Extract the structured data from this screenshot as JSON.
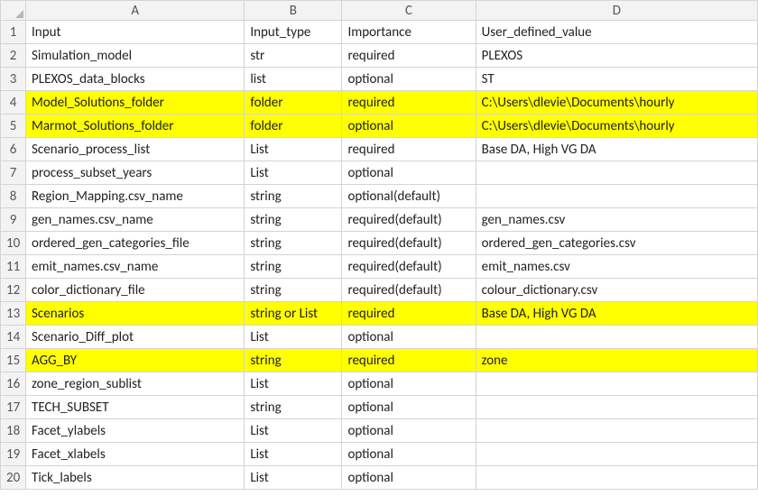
{
  "columns": [
    "A",
    "B",
    "C",
    "D"
  ],
  "rows": [
    {
      "n": 1,
      "hl": false,
      "cells": [
        "Input",
        "Input_type",
        "Importance",
        "User_defined_value"
      ]
    },
    {
      "n": 2,
      "hl": false,
      "cells": [
        "Simulation_model",
        "str",
        "required",
        "PLEXOS"
      ]
    },
    {
      "n": 3,
      "hl": false,
      "cells": [
        "PLEXOS_data_blocks",
        "list",
        "optional",
        "ST"
      ]
    },
    {
      "n": 4,
      "hl": true,
      "cells": [
        "Model_Solutions_folder",
        "folder",
        "required",
        "C:\\Users\\dlevie\\Documents\\hourly"
      ]
    },
    {
      "n": 5,
      "hl": true,
      "cells": [
        "Marmot_Solutions_folder",
        "folder",
        "optional",
        "C:\\Users\\dlevie\\Documents\\hourly"
      ]
    },
    {
      "n": 6,
      "hl": false,
      "cells": [
        "Scenario_process_list",
        "List",
        "required",
        "Base DA, High VG DA"
      ]
    },
    {
      "n": 7,
      "hl": false,
      "cells": [
        "process_subset_years",
        "List",
        "optional",
        ""
      ]
    },
    {
      "n": 8,
      "hl": false,
      "cells": [
        "Region_Mapping.csv_name",
        "string",
        "optional(default)",
        ""
      ]
    },
    {
      "n": 9,
      "hl": false,
      "cells": [
        "gen_names.csv_name",
        "string",
        "required(default)",
        "gen_names.csv"
      ]
    },
    {
      "n": 10,
      "hl": false,
      "cells": [
        "ordered_gen_categories_file",
        "string",
        "required(default)",
        "ordered_gen_categories.csv"
      ]
    },
    {
      "n": 11,
      "hl": false,
      "cells": [
        "emit_names.csv_name",
        "string",
        "required(default)",
        "emit_names.csv"
      ]
    },
    {
      "n": 12,
      "hl": false,
      "cells": [
        "color_dictionary_file",
        "string",
        "required(default)",
        "colour_dictionary.csv"
      ]
    },
    {
      "n": 13,
      "hl": true,
      "cells": [
        "Scenarios",
        "string or List",
        "required",
        "Base DA, High VG DA"
      ]
    },
    {
      "n": 14,
      "hl": false,
      "cells": [
        "Scenario_Diff_plot",
        "List",
        "optional",
        ""
      ]
    },
    {
      "n": 15,
      "hl": true,
      "cells": [
        "AGG_BY",
        "string",
        "required",
        "zone"
      ]
    },
    {
      "n": 16,
      "hl": false,
      "cells": [
        "zone_region_sublist",
        "List",
        "optional",
        ""
      ]
    },
    {
      "n": 17,
      "hl": false,
      "cells": [
        "TECH_SUBSET",
        "string",
        "optional",
        ""
      ]
    },
    {
      "n": 18,
      "hl": false,
      "cells": [
        "Facet_ylabels",
        "List",
        "optional",
        ""
      ]
    },
    {
      "n": 19,
      "hl": false,
      "cells": [
        "Facet_xlabels",
        "List",
        "optional",
        ""
      ]
    },
    {
      "n": 20,
      "hl": false,
      "cells": [
        "Tick_labels",
        "List",
        "optional",
        ""
      ]
    }
  ]
}
